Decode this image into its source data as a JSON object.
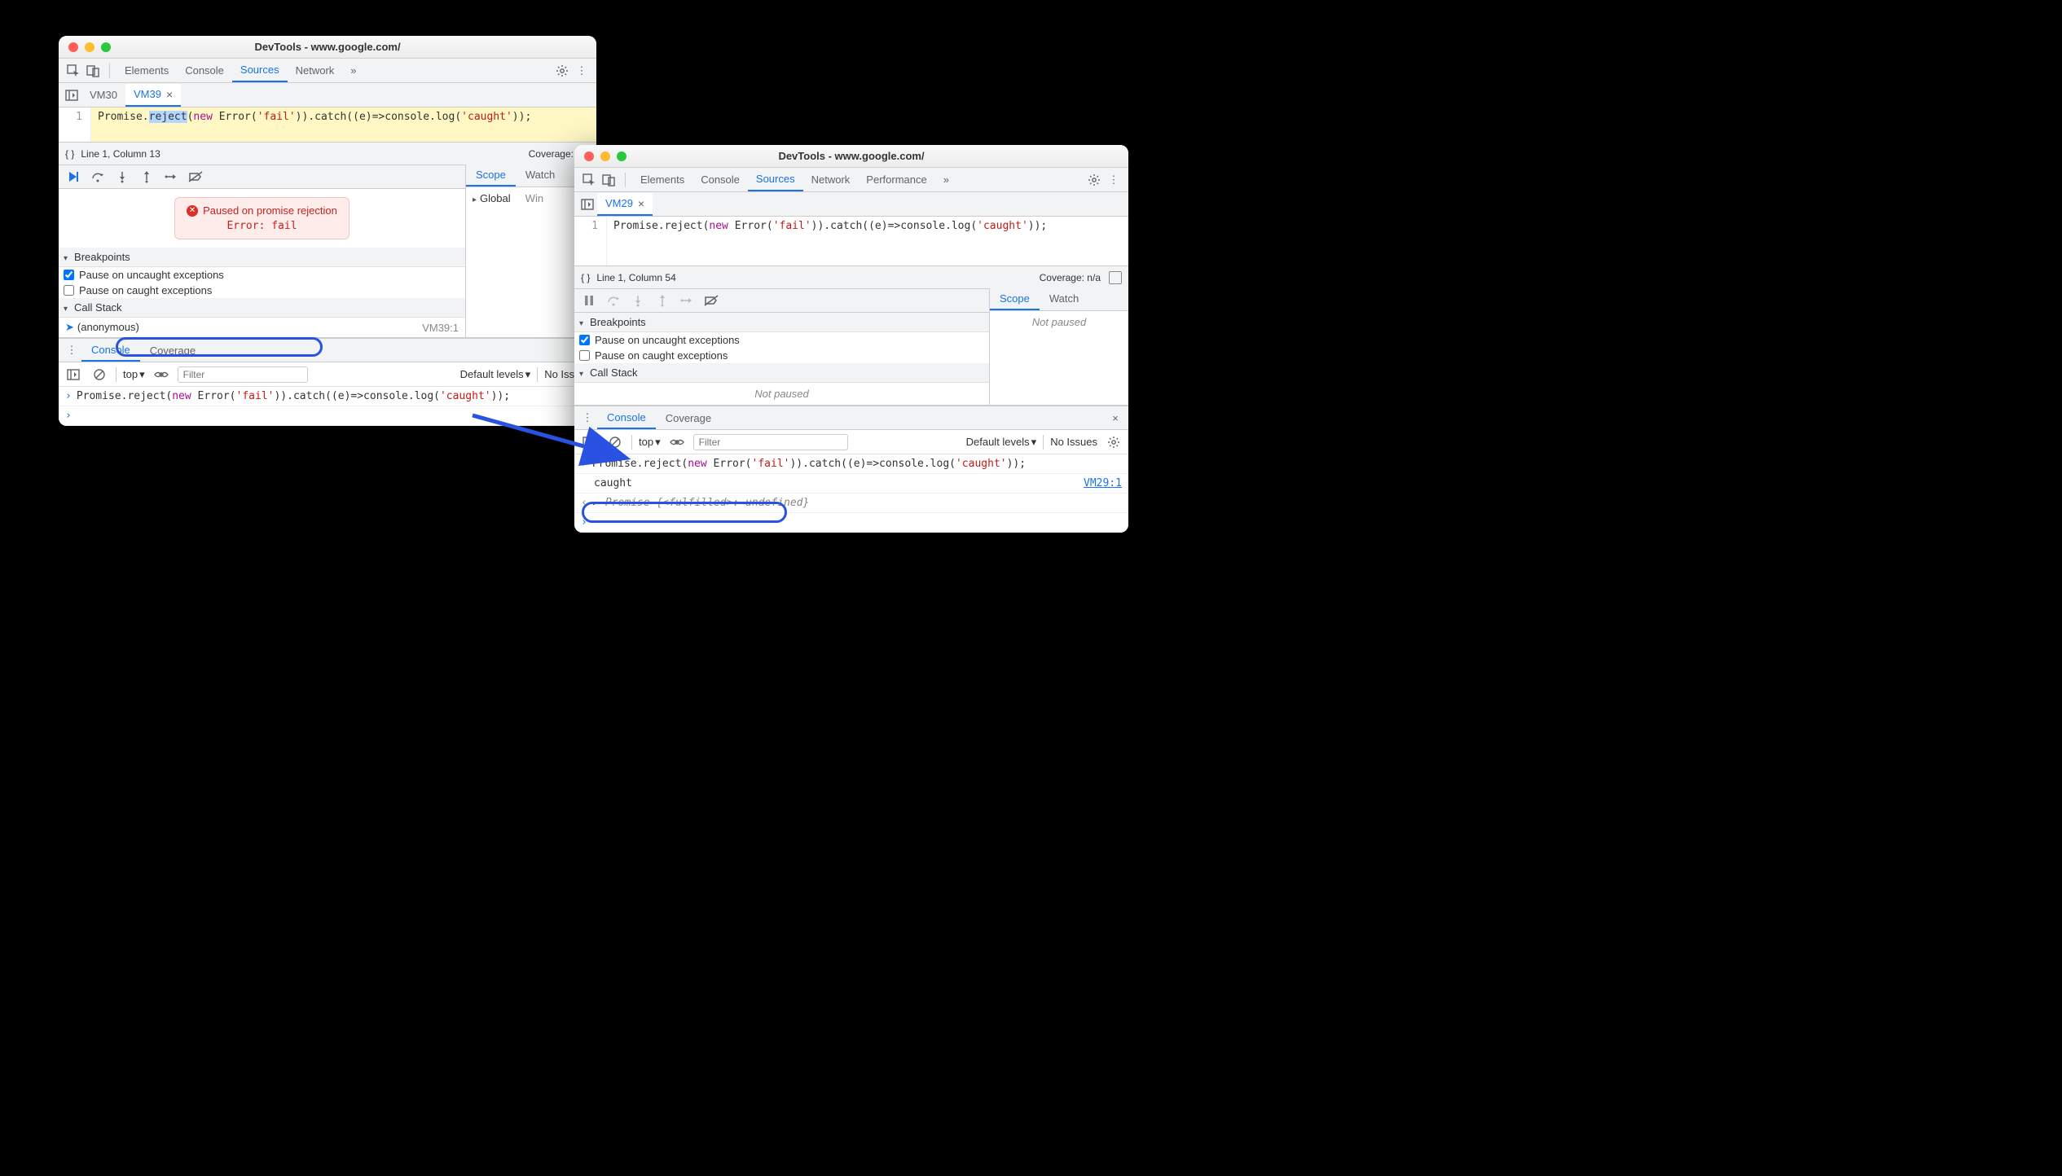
{
  "winA": {
    "title": "DevTools - www.google.com/",
    "mainTabs": [
      "Elements",
      "Console",
      "Sources",
      "Network"
    ],
    "activeTab": "Sources",
    "overflow": "»",
    "fileTabs": {
      "inactive": "VM30",
      "active": "VM39"
    },
    "code": {
      "lineNo": "1",
      "segs": {
        "s1": "Promise.",
        "s2": "reject",
        "s3": "(",
        "s4": "new",
        "s5": " Error(",
        "s6": "'fail'",
        "s7": ")).catch((e)=>console.log(",
        "s8": "'caught'",
        "s9": "));"
      }
    },
    "status": {
      "left": "Line 1, Column 13",
      "right": "Coverage: n/a"
    },
    "paused": {
      "title": "Paused on promise rejection",
      "detail": "Error: fail"
    },
    "sections": {
      "breakpoints": "Breakpoints",
      "bpUncaught": "Pause on uncaught exceptions",
      "bpCaught": "Pause on caught exceptions",
      "callstack": "Call Stack",
      "csItem": "(anonymous)",
      "csLoc": "VM39:1"
    },
    "scope": {
      "tabs": [
        "Scope",
        "Watch"
      ],
      "row": {
        "label": "Global",
        "val": "Win"
      }
    },
    "drawer": {
      "tabs": [
        "Console",
        "Coverage"
      ]
    },
    "consoleTb": {
      "context": "top",
      "filterPH": "Filter",
      "levels": "Default levels",
      "issues": "No Issues"
    },
    "consoleLine": {
      "s1": "Promise.reject(",
      "s2": "new",
      "s3": " Error(",
      "s4": "'fail'",
      "s5": ")).catch((e)=>console.log(",
      "s6": "'caught'",
      "s7": "));"
    }
  },
  "winB": {
    "title": "DevTools - www.google.com/",
    "mainTabs": [
      "Elements",
      "Console",
      "Sources",
      "Network",
      "Performance"
    ],
    "activeTab": "Sources",
    "overflow": "»",
    "fileTabs": {
      "active": "VM29"
    },
    "code": {
      "lineNo": "1",
      "segs": {
        "s1": "Promise.reject(",
        "s2": "new",
        "s3": " Error(",
        "s4": "'fail'",
        "s5": ")).catch((e)=>console.log(",
        "s6": "'caught'",
        "s7": "));"
      }
    },
    "status": {
      "left": "Line 1, Column 54",
      "right": "Coverage: n/a"
    },
    "sections": {
      "breakpoints": "Breakpoints",
      "bpUncaught": "Pause on uncaught exceptions",
      "bpCaught": "Pause on caught exceptions",
      "callstack": "Call Stack",
      "csNotPaused": "Not paused"
    },
    "scope": {
      "tabs": [
        "Scope",
        "Watch"
      ],
      "notPaused": "Not paused"
    },
    "drawer": {
      "tabs": [
        "Console",
        "Coverage"
      ]
    },
    "consoleTb": {
      "context": "top",
      "filterPH": "Filter",
      "levels": "Default levels",
      "issues": "No Issues"
    },
    "consoleLines": {
      "input": {
        "s1": "Promise.reject(",
        "s2": "new",
        "s3": " Error(",
        "s4": "'fail'",
        "s5": ")).catch((e)=>console.log(",
        "s6": "'caught'",
        "s7": "));"
      },
      "out1": {
        "text": "caught",
        "link": "VM29:1"
      },
      "out2": {
        "pre": "Promise ",
        "mid": "{<fulfilled>: undefined}"
      }
    }
  }
}
